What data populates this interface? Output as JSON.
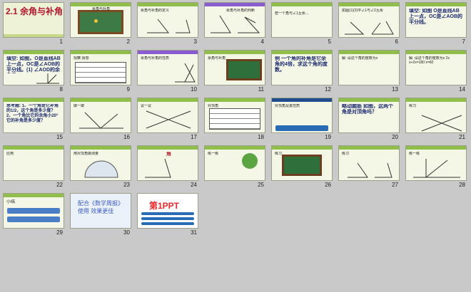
{
  "slides": [
    {
      "n": "1",
      "title": "2.1 余角与补角"
    },
    {
      "n": "2",
      "text": "余角与补角"
    },
    {
      "n": "3",
      "text": "余角与补角的定义"
    },
    {
      "n": "4",
      "text": "余角与补角的判断"
    },
    {
      "n": "5",
      "text": "若一个角与∠1互余…"
    },
    {
      "n": "6",
      "text": "如图(1)(2)中∠1与∠2互余"
    },
    {
      "n": "7",
      "text": "填空: 如图 O是直线AB上一点，OC是∠AOB的平分线。"
    },
    {
      "n": "8",
      "text": "填空: 如图，O是直线AB上一点，OC是∠AOB的平分线。(1) ∠AOD的余角是"
    },
    {
      "n": "9",
      "text": "观察·猜想"
    },
    {
      "n": "10",
      "text": "余角与补角的性质"
    },
    {
      "n": "11",
      "text": "余角与补角"
    },
    {
      "n": "12",
      "text": "例 一个角的补角是它余角的4倍，求这个角的度数。"
    },
    {
      "n": "13",
      "text": "解: 设这个角的度数为x"
    },
    {
      "n": "14",
      "text": "解: 设这个角的度数为x 2x x+2x=180 x=60"
    },
    {
      "n": "15",
      "text": "思考题: 1、一个角是它补角的1/2，这个角是多少度？ 2、一个角比它的余角小20°它的补角是多少度？"
    },
    {
      "n": "16",
      "text": "做一做"
    },
    {
      "n": "17",
      "text": "议一议"
    },
    {
      "n": "18",
      "text": "对顶角"
    },
    {
      "n": "19",
      "text": "对顶角及其性质"
    },
    {
      "n": "20",
      "text": "略动脑筋 如图，这两个角是对顶角吗？"
    },
    {
      "n": "21",
      "text": "练习"
    },
    {
      "n": "22",
      "text": "应用"
    },
    {
      "n": "23",
      "text": "用对顶角做测量"
    },
    {
      "n": "24",
      "text": "角"
    },
    {
      "n": "25",
      "text": "练一练"
    },
    {
      "n": "26",
      "text": "练习"
    },
    {
      "n": "27",
      "text": "练习"
    },
    {
      "n": "28",
      "text": "练一练"
    },
    {
      "n": "29",
      "text": "小结"
    },
    {
      "n": "30",
      "text": "配合《数学周报》使用 效果更佳"
    },
    {
      "n": "31",
      "text": "第1PPT"
    }
  ]
}
